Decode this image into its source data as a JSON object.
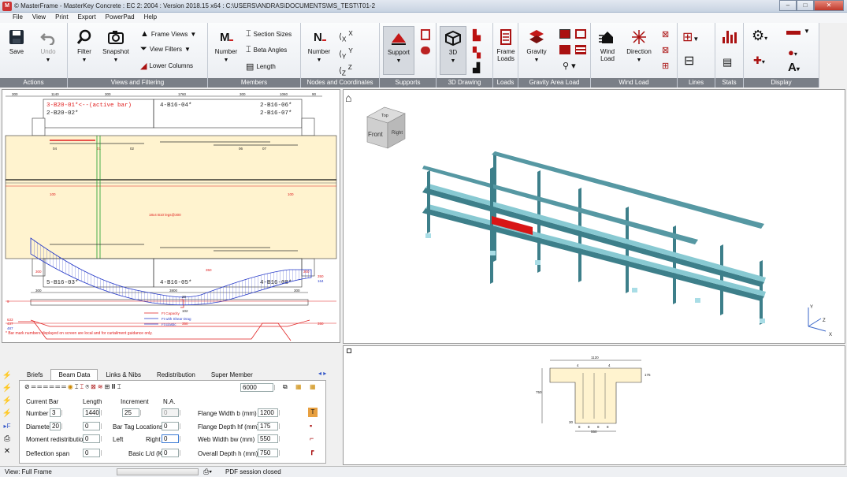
{
  "window": {
    "title": "© MasterFrame - MasterKey Concrete : EC 2: 2004 : Version 2018.15 x64 : C:\\USERS\\ANDRAS\\DOCUMENTS\\MS_TEST\\T01-2",
    "minimize": "–",
    "maximize": "□",
    "close": "✕"
  },
  "menu": [
    "File",
    "View",
    "Print",
    "Export",
    "PowerPad",
    "Help"
  ],
  "ribbon": {
    "actions": {
      "label": "Actions",
      "save": "Save",
      "undo": "Undo"
    },
    "views": {
      "label": "Views and Filtering",
      "filter": "Filter",
      "snapshot": "Snapshot",
      "frame_views": "Frame Views",
      "view_filters": "View Filters",
      "lower_columns": "Lower Columns"
    },
    "members": {
      "label": "Members",
      "number": "Number",
      "section_sizes": "Section Sizes",
      "beta_angles": "Beta Angles",
      "length": "Length"
    },
    "nodes": {
      "label": "Nodes and Coordinates",
      "number": "Number"
    },
    "supports": {
      "label": "Supports",
      "support": "Support"
    },
    "drawing3d": {
      "label": "3D Drawing",
      "btn": "3D"
    },
    "loads": {
      "label": "Loads",
      "frame_loads_1": "Frame",
      "frame_loads_2": "Loads"
    },
    "gravity": {
      "label": "Gravity Area Load",
      "gravity": "Gravity"
    },
    "wind": {
      "label": "Wind Load",
      "wind_1": "Wind",
      "wind_2": "Load",
      "direction": "Direction"
    },
    "lines": {
      "label": "Lines"
    },
    "stats": {
      "label": "Stats"
    },
    "display": {
      "label": "Display"
    }
  },
  "beam_drawing": {
    "dims_top": [
      "300",
      "1140",
      "300",
      "1760",
      "300",
      "1060",
      "90"
    ],
    "top_bars_left_1": "3-B20-01*<--(active bar)",
    "top_bars_left_2": "2-B20-02*",
    "top_bars_mid": "4-B16-04*",
    "top_bars_right_1": "2-B16-06*",
    "top_bars_right_2": "2-B16-07*",
    "marks_top": [
      "04",
      "01",
      "02",
      "06",
      "07"
    ],
    "left_red": "100",
    "right_red": "100",
    "link_label": "18x4 B10 legs@300",
    "bot_bars_left": "5-B16-03*",
    "bot_bars_mid": "4-B16-05*",
    "bot_bars_right": "4-B16-08*",
    "dim_300_left": "300",
    "dim_300_right": "300",
    "dims_bottom": [
      "300",
      "3800",
      "300"
    ],
    "legend": [
      "Ft Capacity",
      "Ft with Shear Drag",
      "Ft Elastic"
    ],
    "diag_labels": {
      "top_left_red": "633",
      "top_left_blue": "487",
      "mid_red_350": "350",
      "right_red_350": "350",
      "right_blue_164": "164",
      "left_red_9": "9",
      "mid_20": "20",
      "mid_102": "102",
      "bottom_left": "437",
      "bottom_mid": "350",
      "bottom_right": "350"
    },
    "note": "* Bar mark numbers displayed on screen are local and for curtailment guidance only."
  },
  "view3d": {
    "cube_top": "Top",
    "cube_front": "Front",
    "cube_right": "Right",
    "axis_x": "X",
    "axis_y": "Y",
    "axis_z": "Z"
  },
  "section": {
    "width_top": "1120",
    "depth_label": "750",
    "flange_label": "175",
    "bot_width": "550",
    "marks": [
      "4",
      "4",
      "8",
      "8",
      "8",
      "8"
    ],
    "side_30": "30"
  },
  "tabs": [
    "Briefs",
    "Beam Data",
    "Links & Nibs",
    "Redistribution",
    "Super Member"
  ],
  "beam_data": {
    "toolbar_value": "6000",
    "current_bar": "Current Bar",
    "col_length": "Length",
    "col_increment": "Increment",
    "col_na": "N.A.",
    "number_lbl": "Number",
    "number_val": "3",
    "length_val": "1440",
    "increment_val": "25",
    "na_val": "0",
    "diameter_lbl": "Diameter",
    "diameter_val": "20",
    "bartag_val": "0",
    "bartag_lbl": "Bar Tag Locations",
    "bartag2_val": "0",
    "moment_lbl": "Moment redistribution",
    "moment_val": "0",
    "left_lbl": "Left",
    "right_lbl": "Right",
    "right_val": "0",
    "deflection_lbl": "Deflection span",
    "deflection_val": "0",
    "basic_lbl": "Basic L/d (K)",
    "basic_val": "0",
    "flange_width_lbl": "Flange Width  b (mm)",
    "flange_width_val": "1200",
    "flange_depth_lbl": "Flange Depth hf (mm)",
    "flange_depth_val": "175",
    "web_width_lbl": "Web Width    bw (mm)",
    "web_width_val": "550",
    "overall_depth_lbl": "Overall Depth  h (mm)",
    "overall_depth_val": "750"
  },
  "status": {
    "view": "View: Full Frame",
    "pdf": "PDF session closed"
  },
  "colors": {
    "beam_fill": "#fff3cf",
    "red": "#e02020",
    "blue": "#2438c8",
    "frame": "#3d7f8a",
    "frame_light": "#88c9d2",
    "active": "#d81616"
  }
}
